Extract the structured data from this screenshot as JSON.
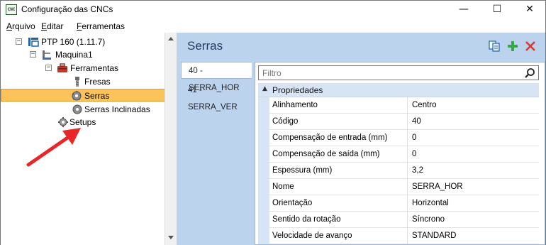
{
  "window": {
    "app_icon_text": "CNC",
    "title": "Configuração das CNCs",
    "minimize_glyph": "—",
    "maximize_glyph": "☐",
    "close_glyph": "✕"
  },
  "menu": {
    "items": [
      {
        "accel": "A",
        "rest": "rquivo"
      },
      {
        "accel": "E",
        "rest": "ditar"
      },
      {
        "accel": "F",
        "rest": "erramentas"
      }
    ]
  },
  "tree": {
    "items": [
      {
        "label": "PTP 160 (1.11.7)",
        "icon": "cnc-machine-icon",
        "expanded": true
      },
      {
        "label": "Maquina1",
        "icon": "machine-icon",
        "expanded": true
      },
      {
        "label": "Ferramentas",
        "icon": "toolbox-icon",
        "expanded": true
      },
      {
        "label": "Fresas",
        "icon": "drill-bit-icon"
      },
      {
        "label": "Serras",
        "icon": "saw-icon",
        "selected": true
      },
      {
        "label": "Serras Inclinadas",
        "icon": "saw-icon"
      },
      {
        "label": "Setups",
        "icon": "gear-icon"
      }
    ],
    "toggle_glyph": "−"
  },
  "panel": {
    "title": "Serras",
    "tabs": [
      {
        "label": "40 - SERRA_HOR",
        "active": true
      },
      {
        "label": "41 - SERRA_VER",
        "active": false
      }
    ],
    "filter_placeholder": "Filtro",
    "category": {
      "toggle_glyph": "▲",
      "label": "Propriedades"
    },
    "properties": [
      {
        "name": "Alinhamento",
        "value": "Centro"
      },
      {
        "name": "Código",
        "value": "40"
      },
      {
        "name": "Compensação de entrada (mm)",
        "value": "0"
      },
      {
        "name": "Compensação de saída (mm)",
        "value": "0"
      },
      {
        "name": "Espessura (mm)",
        "value": "3,2"
      },
      {
        "name": "Nome",
        "value": "SERRA_HOR"
      },
      {
        "name": "Orientação",
        "value": "Horizontal"
      },
      {
        "name": "Sentido da rotação",
        "value": "Síncrono"
      },
      {
        "name": "Velocidade de avanço",
        "value": "STANDARD"
      }
    ]
  },
  "colors": {
    "selected_tree_item": "#fbc35a",
    "panel_background": "#bcd3ee",
    "category_row": "#d7e4f4",
    "annotation_arrow": "#e8262a",
    "add_icon": "#3aa64a",
    "delete_icon": "#d93636"
  }
}
